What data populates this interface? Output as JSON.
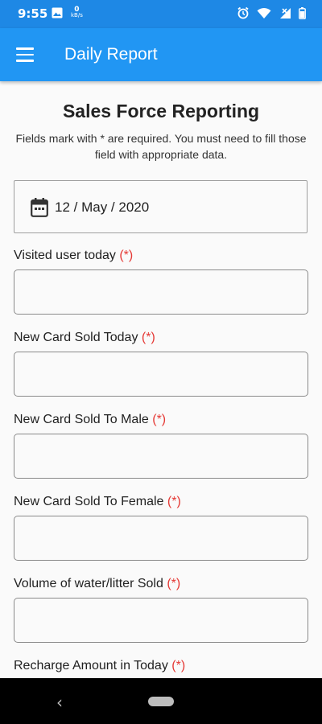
{
  "status_bar": {
    "time": "9:55",
    "data_rate_value": "0",
    "data_rate_unit": "kB/s",
    "icons": [
      "image-icon",
      "alarm-icon",
      "wifi-icon",
      "signal-icon",
      "battery-icon"
    ]
  },
  "app_bar": {
    "title": "Daily Report",
    "menu_icon": "menu-icon"
  },
  "form": {
    "heading": "Sales Force Reporting",
    "subtitle": "Fields mark with * are required. You must need to fill those field with appropriate data.",
    "date": "12 / May / 2020",
    "required_marker": "(*)",
    "fields": [
      {
        "label": "Visited user today",
        "value": ""
      },
      {
        "label": "New Card Sold Today",
        "value": ""
      },
      {
        "label": "New Card Sold To Male",
        "value": ""
      },
      {
        "label": "New Card Sold To Female",
        "value": ""
      },
      {
        "label": "Volume of water/litter Sold",
        "value": ""
      },
      {
        "label": "Recharge Amount in Today",
        "value": ""
      }
    ]
  },
  "nav_bar": {
    "back_glyph": "‹"
  },
  "colors": {
    "status_bar": "#1e88e5",
    "app_bar": "#2196f3",
    "required": "#e53935"
  }
}
